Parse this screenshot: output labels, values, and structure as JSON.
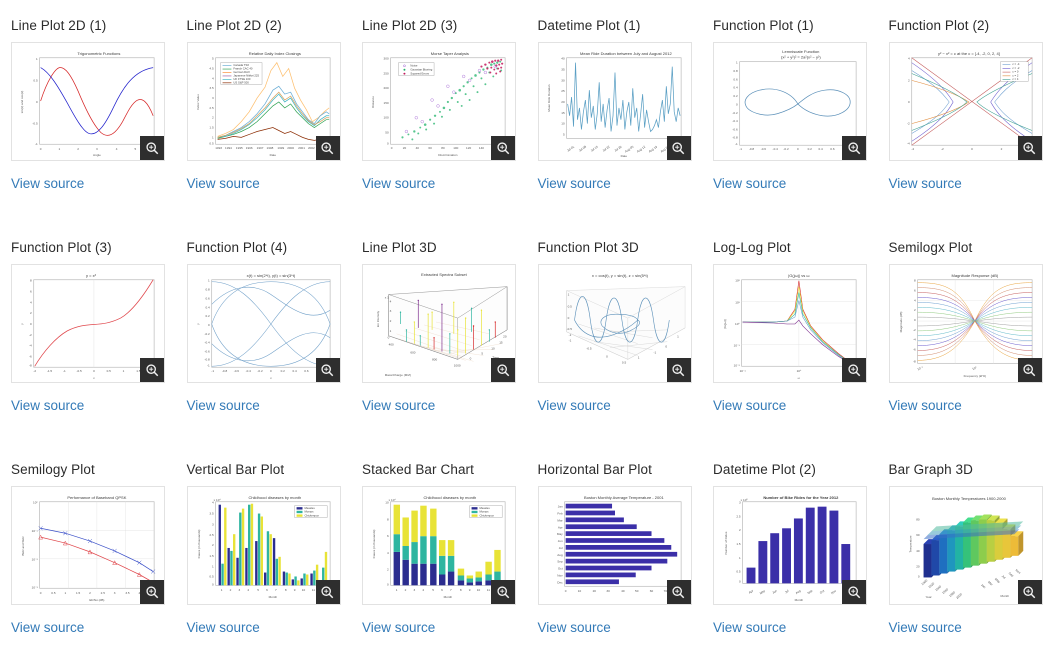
{
  "page": {
    "link_label": "View source",
    "zoom_icon": "magnifier-plus-icon",
    "link_color": "#337ab7",
    "title_color": "#2b2b2b"
  },
  "items": [
    {
      "title": "Line Plot 2D (1)",
      "link": "View source",
      "plot": {
        "chart_title": "Trigonometric Functions",
        "xlabel": "Angle",
        "ylabel": "sin(x) and cos(x)",
        "xticks": [
          "0",
          "1",
          "2",
          "3",
          "4",
          "5",
          "6"
        ],
        "yticks": [
          "-1",
          "-0.5",
          "0",
          "0.5",
          "1"
        ],
        "series": [
          "sin(x)",
          "cos(x)"
        ],
        "colors": [
          "#d62728",
          "#2222cc"
        ]
      }
    },
    {
      "title": "Line Plot 2D (2)",
      "link": "View source",
      "plot": {
        "chart_title": "Relative Daily Index Closings",
        "xlabel": "Date",
        "ylabel": "Index Value",
        "xticks": [
          "1993",
          "1994",
          "1995",
          "1996",
          "1997",
          "1998",
          "1999",
          "2000",
          "2001",
          "2002",
          "2003",
          "2004"
        ],
        "yticks": [
          "0.5",
          "1",
          "1.5",
          "2",
          "2.5",
          "3",
          "3.5",
          "4",
          "4.5",
          "5"
        ],
        "legend": [
          "Canada TSX",
          "Franch CAC 40",
          "German DAX",
          "Japanese Nikkei 225",
          "UK FTSE 100",
          "US S&P 500"
        ],
        "colors": [
          "#6baed6",
          "#31a354",
          "#fd8d3c",
          "#9e5fa8",
          "#41b6c4",
          "#8c2d04"
        ]
      }
    },
    {
      "title": "Line Plot 2D (3)",
      "link": "View source",
      "plot": {
        "chart_title": "Morse Taper Analysis",
        "xlabel": "Discrimination",
        "ylabel": "Distance",
        "xticks": [
          "0",
          "20",
          "40",
          "60",
          "80",
          "100",
          "120",
          "140",
          "160",
          "180"
        ],
        "yticks": [
          "0",
          "50",
          "100",
          "150",
          "200",
          "250",
          "300"
        ],
        "legend": [
          "Noise",
          "Gaussian Blurring",
          "Squared Errors"
        ],
        "colors": [
          "#9b59d0",
          "#21b36b",
          "#c2185b"
        ]
      }
    },
    {
      "title": "Datetime Plot (1)",
      "link": "View source",
      "plot": {
        "chart_title": "Mean Ride Duration between July and August 2012",
        "xlabel": "Date",
        "ylabel": "Mean Ride Duration",
        "corner_note": "2012",
        "yticks": [
          "5",
          "10",
          "15",
          "20",
          "25",
          "30",
          "35",
          "40"
        ],
        "color": "#5a9fc4"
      }
    },
    {
      "title": "Function Plot (1)",
      "link": "View source",
      "plot": {
        "chart_title": "Lemniscate Function",
        "chart_subtitle": "(x² + y²)² = 2a²(x² − y²)",
        "xticks": [
          "-1",
          "-0.8",
          "-0.6",
          "-0.4",
          "-0.2",
          "0",
          "0.2",
          "0.4",
          "0.6",
          "0.8",
          "1"
        ],
        "yticks": [
          "-1",
          "-0.8",
          "-0.6",
          "-0.4",
          "-0.2",
          "0",
          "0.2",
          "0.4",
          "0.6",
          "0.8",
          "1"
        ],
        "color": "#5a8fb8"
      }
    },
    {
      "title": "Function Plot (2)",
      "link": "View source",
      "plot": {
        "chart_title": "y² − x² = c at the c = [-4, -2, 0, 2, 4]",
        "legend": [
          "c = -4",
          "c = -2",
          "c = 0",
          "c = 2",
          "c = 4"
        ],
        "xticks": [
          "-4",
          "-2",
          "0",
          "2",
          "4"
        ],
        "yticks": [
          "-4",
          "-2",
          "0",
          "2",
          "4"
        ],
        "colors": [
          "#6d9fd0",
          "#6a5acd",
          "#c45b5b",
          "#e08c3e",
          "#3b9e8f"
        ]
      }
    },
    {
      "title": "Function Plot (3)",
      "link": "View source",
      "plot": {
        "chart_title": "y = x³",
        "xlabel": "x",
        "ylabel": "y",
        "xticks": [
          "-2",
          "-1.5",
          "-1",
          "-0.5",
          "0",
          "0.5",
          "1",
          "1.5",
          "2"
        ],
        "yticks": [
          "-8",
          "-6",
          "-4",
          "-2",
          "0",
          "2",
          "4",
          "6",
          "8"
        ],
        "color": "#e0474c"
      }
    },
    {
      "title": "Function Plot (4)",
      "link": "View source",
      "plot": {
        "chart_title": "x(t) = sin(2*t), y(t) = sin(3*t)",
        "xlabel": "x",
        "ylabel": "y",
        "xticks": [
          "-1",
          "-0.8",
          "-0.6",
          "-0.4",
          "-0.2",
          "0",
          "0.2",
          "0.4",
          "0.6",
          "0.8",
          "1"
        ],
        "yticks": [
          "-1",
          "-0.8",
          "-0.6",
          "-0.4",
          "-0.2",
          "0",
          "0.2",
          "0.4",
          "0.6",
          "0.8",
          "1"
        ],
        "color": "#6f9fc8"
      }
    },
    {
      "title": "Line Plot 3D",
      "link": "View source",
      "plot": {
        "chart_title": "Extracted Spectra Subset",
        "xlabel": "Mass/Charge (M/Z)",
        "ylabel": "Ion Intensity",
        "zlabel": "Time",
        "exponent": "x 10⁴",
        "xticks": [
          "400",
          "600",
          "800",
          "1000"
        ],
        "zticks": [
          "0",
          "5",
          "10",
          "15",
          "20"
        ],
        "yticks": [
          "0",
          "1",
          "2",
          "3",
          "4"
        ]
      }
    },
    {
      "title": "Function Plot 3D",
      "link": "View source",
      "plot": {
        "chart_title": "x = cos(t), y = sin(t), z = sin(5*t)",
        "xticks": [
          "-1",
          "-0.5",
          "0",
          "0.5",
          "1"
        ],
        "yticks": [
          "-1",
          "-0.5",
          "0",
          "0.5",
          "1"
        ],
        "zticks": [
          "-1",
          "-0.5",
          "0",
          "0.5",
          "1"
        ],
        "color": "#5a8fb8"
      }
    },
    {
      "title": "Log-Log Plot",
      "link": "View source",
      "plot": {
        "chart_title": "|G(jω)| vs ω",
        "xlabel": "ω",
        "ylabel": "|G(jω)|",
        "xticks": [
          "10⁻¹",
          "10⁰",
          "10¹"
        ],
        "yticks": [
          "10⁻²",
          "10⁻¹",
          "10⁰",
          "10¹",
          "10²"
        ]
      }
    },
    {
      "title": "Semilogx Plot",
      "link": "View source",
      "plot": {
        "chart_title": "Magnitude Response (dB)",
        "xlabel": "Frequency (kHz)",
        "ylabel": "Magnitude (dB)",
        "xticks": [
          "10⁻¹",
          "10⁰",
          "10¹"
        ],
        "yticks": [
          "-8",
          "-6",
          "-4",
          "-2",
          "0",
          "2",
          "4",
          "6",
          "8"
        ]
      }
    },
    {
      "title": "Semilogy Plot",
      "link": "View source",
      "plot": {
        "chart_title": "Performance of Baseband QPSK",
        "xlabel": "Eb/No (dB)",
        "ylabel": "BER and SER",
        "xticks": [
          "0",
          "0.5",
          "1",
          "1.5",
          "2",
          "2.5",
          "3",
          "3.5",
          "4",
          "4.5"
        ],
        "yticks": [
          "10⁻³",
          "10⁻²",
          "10⁻¹",
          "10⁰"
        ],
        "colors": [
          "#3b50c8",
          "#e0474c"
        ]
      }
    },
    {
      "title": "Vertical Bar Plot",
      "link": "View source",
      "plot": {
        "chart_title": "Childhood diseases by month",
        "xlabel": "Month",
        "ylabel": "Cases (in thousands)",
        "exponent": "x 10⁴",
        "legend": [
          "Measles",
          "Mumps",
          "Chickenpox"
        ],
        "colors": [
          "#2b2d8f",
          "#2eb5a0",
          "#e8e337"
        ],
        "categories": [
          "1",
          "2",
          "3",
          "4",
          "5",
          "6",
          "7",
          "8",
          "9",
          "10",
          "11",
          "12"
        ],
        "yticks": [
          "0",
          "0.5",
          "1",
          "1.5",
          "2",
          "2.5",
          "3",
          "3.5",
          "4"
        ]
      }
    },
    {
      "title": "Stacked Bar Chart",
      "link": "View source",
      "plot": {
        "chart_title": "Childhood diseases by month",
        "xlabel": "Month",
        "ylabel": "Cases (in thousands)",
        "exponent": "x 10⁴",
        "legend": [
          "Measles",
          "Mumps",
          "Chickenpox"
        ],
        "colors": [
          "#2b2d8f",
          "#2eb5a0",
          "#e8e337"
        ],
        "categories": [
          "1",
          "2",
          "3",
          "4",
          "5",
          "6",
          "7",
          "8",
          "9",
          "10",
          "11",
          "12"
        ],
        "yticks": [
          "0",
          "2",
          "4",
          "6",
          "8",
          "10"
        ]
      }
    },
    {
      "title": "Horizontal Bar Plot",
      "link": "View source",
      "plot": {
        "chart_title": "Boston Monthly Average Temperature - 2001",
        "categories": [
          "Jan",
          "Feb",
          "Mar",
          "Apr",
          "May",
          "Jun",
          "Jul",
          "Aug",
          "Sep",
          "Oct",
          "Nov",
          "Dec"
        ],
        "values": [
          32,
          34,
          40,
          49,
          59,
          68,
          73,
          77,
          70,
          59,
          48,
          37
        ],
        "xticks": [
          "0",
          "10",
          "20",
          "30",
          "40",
          "50",
          "60",
          "70",
          "80"
        ],
        "color": "#3b2fa8"
      }
    },
    {
      "title": "Datetime Plot (2)",
      "link": "View source",
      "plot": {
        "chart_title": "Number of Bike Rides for the Year 2012",
        "xlabel": "Month",
        "ylabel": "Number of Rides",
        "exponent": "x 10⁵",
        "corner_note": "2012",
        "yticks": [
          "0",
          "0.5",
          "1",
          "1.5",
          "2",
          "2.5",
          "3"
        ],
        "values": [
          0.55,
          1.55,
          1.85,
          2.05,
          2.4,
          2.8,
          2.85,
          2.7,
          1.45
        ],
        "color": "#3b2fa8"
      }
    },
    {
      "title": "Bar Graph 3D",
      "link": "View source",
      "plot": {
        "chart_title": "Boston Monthly Temperatures 1900-2000",
        "xlabel": "Month",
        "ylabel": "Year",
        "zlabel": "Temperature",
        "zticks": [
          "0",
          "20",
          "40",
          "60",
          "80"
        ]
      }
    }
  ]
}
